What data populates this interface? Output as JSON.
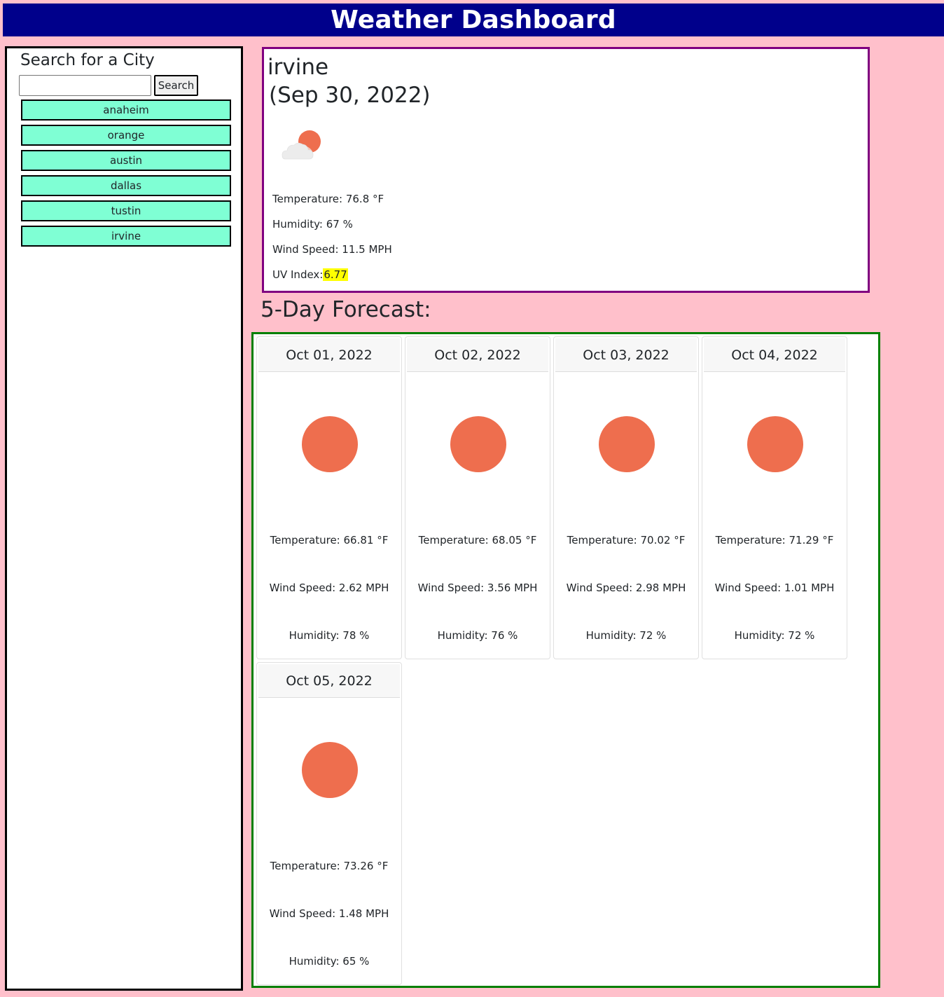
{
  "header": {
    "title": "Weather Dashboard"
  },
  "sidebar": {
    "title": "Search for a City",
    "search": {
      "value": "",
      "placeholder": ""
    },
    "search_button_label": "Search",
    "history": [
      "anaheim",
      "orange",
      "austin",
      "dallas",
      "tustin",
      "irvine"
    ]
  },
  "current": {
    "city": "irvine",
    "date": "(Sep 30, 2022)",
    "icon": "partly-cloudy-icon",
    "temperature": "Temperature: 76.8 °F",
    "humidity": "Humidity: 67 %",
    "wind": "Wind Speed: 11.5 MPH",
    "uv_label": "UV Index:",
    "uv_value": "6.77",
    "uv_color": "#ffff00"
  },
  "forecast": {
    "title": "5-Day Forecast:",
    "days": [
      {
        "date": "Oct 01, 2022",
        "icon": "sun-icon",
        "temperature": "Temperature: 66.81 °F",
        "wind": "Wind Speed: 2.62 MPH",
        "humidity": "Humidity: 78 %"
      },
      {
        "date": "Oct 02, 2022",
        "icon": "sun-icon",
        "temperature": "Temperature: 68.05 °F",
        "wind": "Wind Speed: 3.56 MPH",
        "humidity": "Humidity: 76 %"
      },
      {
        "date": "Oct 03, 2022",
        "icon": "sun-icon",
        "temperature": "Temperature: 70.02 °F",
        "wind": "Wind Speed: 2.98 MPH",
        "humidity": "Humidity: 72 %"
      },
      {
        "date": "Oct 04, 2022",
        "icon": "sun-icon",
        "temperature": "Temperature: 71.29 °F",
        "wind": "Wind Speed: 1.01 MPH",
        "humidity": "Humidity: 72 %"
      },
      {
        "date": "Oct 05, 2022",
        "icon": "sun-icon",
        "temperature": "Temperature: 73.26 °F",
        "wind": "Wind Speed: 1.48 MPH",
        "humidity": "Humidity: 65 %"
      }
    ]
  },
  "colors": {
    "page_bg": "#ffc0cb",
    "header_bg": "#00008b",
    "history_btn_bg": "#7fffd4",
    "current_border": "#800080",
    "forecast_border": "#008000",
    "sun": "#ee6e4e"
  }
}
